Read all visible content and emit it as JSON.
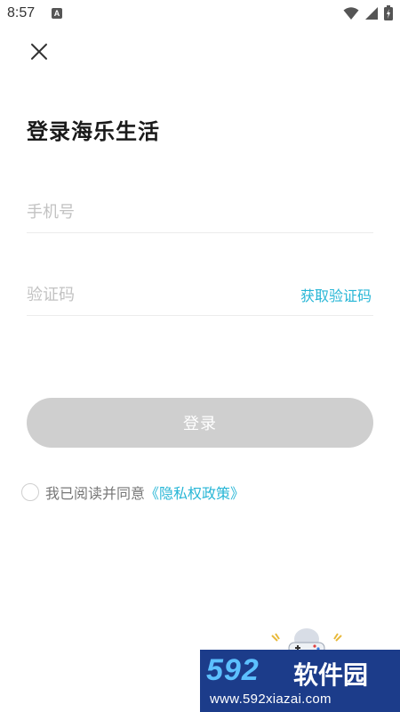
{
  "status_bar": {
    "time": "8:57",
    "notification_icon": "a-icon",
    "notification_letter": "A"
  },
  "title": "登录海乐生活",
  "form": {
    "phone_placeholder": "手机号",
    "phone_value": "",
    "code_placeholder": "验证码",
    "code_value": "",
    "get_code_label": "获取验证码",
    "login_label": "登录"
  },
  "agreement": {
    "checked": false,
    "text": "我已阅读并同意",
    "policy_link": "《隐私权政策》"
  },
  "watermark": {
    "number": "592",
    "name": "软件园",
    "url": "www.592xiazai.com"
  },
  "colors": {
    "accent": "#27b6d6",
    "button_disabled": "#cfcfcf",
    "placeholder": "#c2c2c2",
    "watermark_bg": "#1c3c8a"
  }
}
